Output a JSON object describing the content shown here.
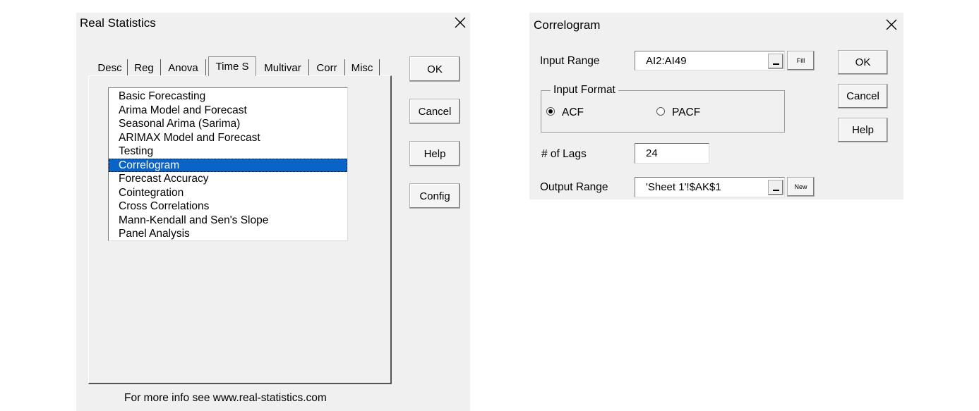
{
  "left_dialog": {
    "title": "Real Statistics",
    "tabs": [
      "Desc",
      "Reg",
      "Anova",
      "Time S",
      "Multivar",
      "Corr",
      "Misc"
    ],
    "active_tab": "Time S",
    "list_items": [
      "Basic Forecasting",
      "Arima Model and Forecast",
      "Seasonal Arima (Sarima)",
      "ARIMAX Model and Forecast",
      "Testing",
      "Correlogram",
      "Forecast Accuracy",
      "Cointegration",
      "Cross Correlations",
      "Mann-Kendall and Sen's Slope",
      "Panel Analysis"
    ],
    "selected_item": "Correlogram",
    "buttons": {
      "ok": "OK",
      "cancel": "Cancel",
      "help": "Help",
      "config": "Config"
    },
    "footer": "For more info see www.real-statistics.com"
  },
  "right_dialog": {
    "title": "Correlogram",
    "input_range_label": "Input Range",
    "input_range_value": "AI2:AI49",
    "fill_button": "Fill",
    "input_format_legend": "Input Format",
    "acf_label": "ACF",
    "pacf_label": "PACF",
    "selected_format": "ACF",
    "lags_label": "# of Lags",
    "lags_value": "24",
    "output_range_label": "Output Range",
    "output_range_value": "'Sheet 1'!$AK$1",
    "new_button": "New",
    "buttons": {
      "ok": "OK",
      "cancel": "Cancel",
      "help": "Help"
    }
  }
}
